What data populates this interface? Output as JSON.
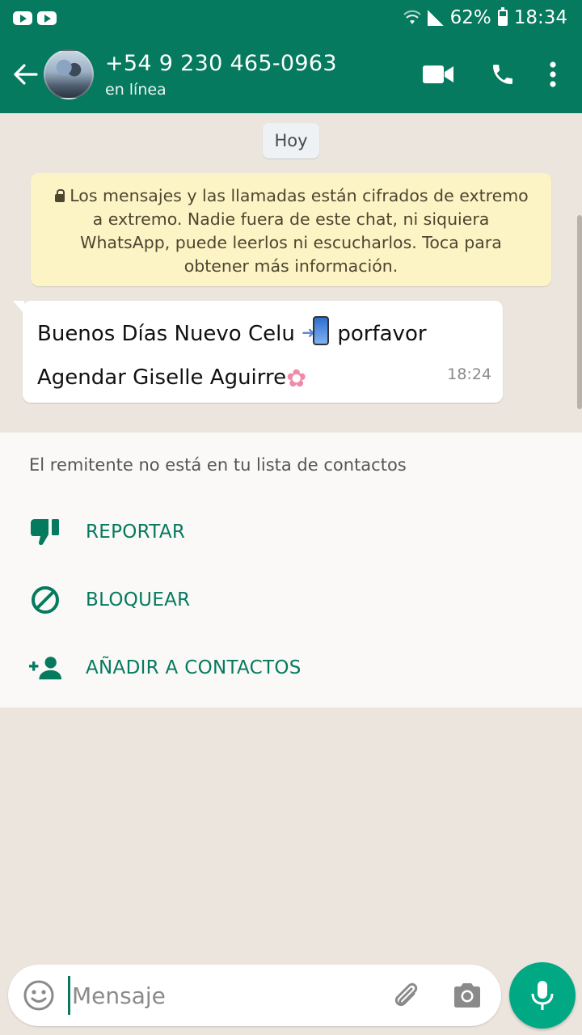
{
  "status_bar": {
    "battery": "62%",
    "time": "18:34"
  },
  "header": {
    "contact": "+54 9 230 465-0963",
    "status": "en línea"
  },
  "chat": {
    "date_chip": "Hoy",
    "encryption_notice": "Los mensajes y las llamadas están cifrados de extremo a extremo. Nadie fuera de este chat, ni siquiera WhatsApp, puede leerlos ni escucharlos. Toca para obtener más información.",
    "message": {
      "line1_part1": "Buenos Días Nuevo Celu",
      "line1_part2": "porfavor",
      "line2": "Agendar Giselle Aguirre",
      "time": "18:24"
    }
  },
  "sender_panel": {
    "note": "El remitente no está en tu lista de contactos",
    "actions": [
      {
        "label": "REPORTAR",
        "icon": "thumbs-down-icon"
      },
      {
        "label": "BLOQUEAR",
        "icon": "block-icon"
      },
      {
        "label": "AÑADIR A CONTACTOS",
        "icon": "add-contact-icon"
      }
    ]
  },
  "composer": {
    "placeholder": "Mensaje"
  },
  "colors": {
    "primary": "#057a5e",
    "accent": "#00a884",
    "chat_background": "#ece5dd",
    "notice_background": "#fdf4c5"
  }
}
